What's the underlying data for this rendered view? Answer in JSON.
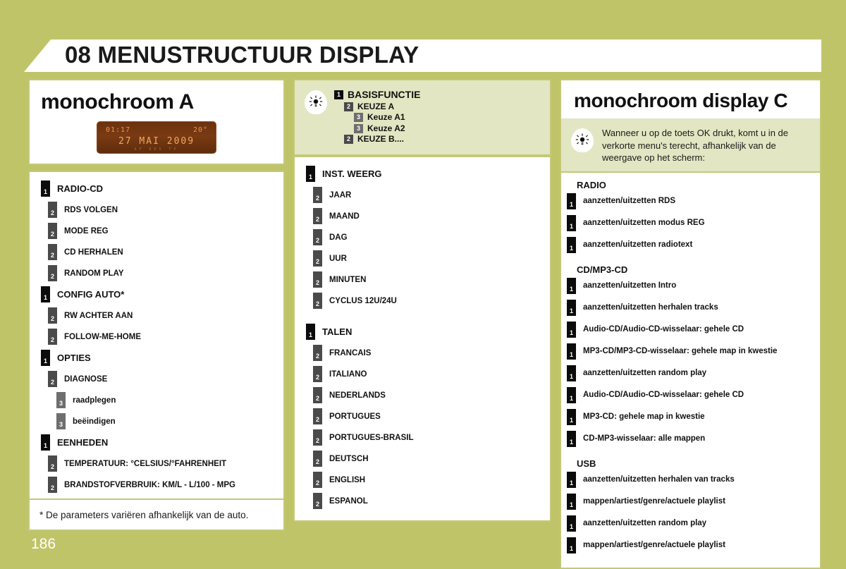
{
  "header": {
    "title": "08 MENUSTRUCTUUR DISPLAY"
  },
  "page_number": "186",
  "footnote": "* De parameters variëren afhankelijk van de auto.",
  "column1": {
    "title": "monochroom A",
    "display": {
      "time": "01:17",
      "temperature": "20°",
      "date": "27 MAI 2009",
      "substrip": "AF  RDS  TP"
    },
    "tree": [
      {
        "level": 1,
        "label": "RADIO-CD"
      },
      {
        "level": 2,
        "label": "RDS VOLGEN"
      },
      {
        "level": 2,
        "label": "MODE REG"
      },
      {
        "level": 2,
        "label": "CD HERHALEN"
      },
      {
        "level": 2,
        "label": "RANDOM PLAY"
      },
      {
        "level": 1,
        "label": "CONFIG AUTO*"
      },
      {
        "level": 2,
        "label": "RW ACHTER AAN"
      },
      {
        "level": 2,
        "label": "FOLLOW-ME-HOME"
      },
      {
        "level": 1,
        "label": "OPTIES"
      },
      {
        "level": 2,
        "label": "DIAGNOSE"
      },
      {
        "level": 3,
        "label": "raadplegen"
      },
      {
        "level": 3,
        "label": "beëindigen"
      },
      {
        "level": 1,
        "label": "EENHEDEN"
      },
      {
        "level": 2,
        "label": "TEMPERATUUR: °CELSIUS/°FAHRENHEIT"
      },
      {
        "level": 2,
        "label": "BRANDSTOFVERBRUIK: KM/L - L/100 - MPG"
      }
    ]
  },
  "column2": {
    "legend": [
      {
        "level": 1,
        "label": "BASISFUNCTIE"
      },
      {
        "level": 2,
        "label": "KEUZE A"
      },
      {
        "level": 3,
        "label": "Keuze A1"
      },
      {
        "level": 3,
        "label": "Keuze A2"
      },
      {
        "level": 2,
        "label": "KEUZE B...."
      }
    ],
    "tree": [
      {
        "level": 1,
        "label": "INST. WEERG"
      },
      {
        "level": 2,
        "label": "JAAR"
      },
      {
        "level": 2,
        "label": "MAAND"
      },
      {
        "level": 2,
        "label": "DAG"
      },
      {
        "level": 2,
        "label": "UUR"
      },
      {
        "level": 2,
        "label": "MINUTEN"
      },
      {
        "level": 2,
        "label": "CYCLUS 12U/24U"
      },
      {
        "level": 0,
        "label": ""
      },
      {
        "level": 1,
        "label": "TALEN"
      },
      {
        "level": 2,
        "label": "FRANCAIS"
      },
      {
        "level": 2,
        "label": "ITALIANO"
      },
      {
        "level": 2,
        "label": "NEDERLANDS"
      },
      {
        "level": 2,
        "label": "PORTUGUES"
      },
      {
        "level": 2,
        "label": "PORTUGUES-BRASIL"
      },
      {
        "level": 2,
        "label": "DEUTSCH"
      },
      {
        "level": 2,
        "label": "ENGLISH"
      },
      {
        "level": 2,
        "label": "ESPANOL"
      }
    ]
  },
  "column3": {
    "title": "monochroom display C",
    "note": "Wanneer u op de toets OK drukt, komt u in de verkorte menu's terecht, afhankelijk van de weergave op het scherm:",
    "sections": [
      {
        "name": "RADIO",
        "items": [
          "aanzetten/uitzetten RDS",
          "aanzetten/uitzetten modus REG",
          "aanzetten/uitzetten radiotext"
        ]
      },
      {
        "name": "CD/MP3-CD",
        "items": [
          "aanzetten/uitzetten Intro",
          "aanzetten/uitzetten herhalen tracks",
          "Audio-CD/Audio-CD-wisselaar: gehele CD",
          "MP3-CD/MP3-CD-wisselaar: gehele map in kwestie",
          "aanzetten/uitzetten random play",
          "Audio-CD/Audio-CD-wisselaar: gehele CD",
          "MP3-CD: gehele map in kwestie",
          "CD-MP3-wisselaar: alle mappen"
        ]
      },
      {
        "name": "USB",
        "items": [
          "aanzetten/uitzetten herhalen van tracks",
          "mappen/artiest/genre/actuele playlist",
          "aanzetten/uitzetten random play",
          "mappen/artiest/genre/actuele playlist"
        ]
      }
    ]
  },
  "colors": {
    "page_background": "#c0c468",
    "panel_border": "#c4c878",
    "legend_background": "#e2e6c2",
    "badge_level1": "#0b0b0b",
    "badge_level2": "#4a4a4a",
    "badge_level3": "#6e6e6e",
    "display_screen": "#7a3a12",
    "display_text": "#e8954a"
  }
}
